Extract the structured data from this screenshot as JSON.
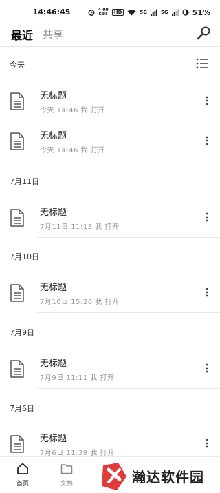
{
  "status_bar": {
    "time": "14:46:45",
    "net_speed_top": "4.00",
    "net_speed_bottom": "KB/S",
    "hd": "HD",
    "signal_1": "5G",
    "signal_2": "5G",
    "battery": "51%"
  },
  "header": {
    "tab_recent": "最近",
    "tab_share": "共享"
  },
  "sections": [
    {
      "title": "今天",
      "files": [
        {
          "name": "无标题",
          "meta": "今天 14:46 我 打开"
        },
        {
          "name": "无标题",
          "meta": "今天 14:46 我 打开"
        }
      ]
    },
    {
      "title": "7月11日",
      "files": [
        {
          "name": "无标题",
          "meta": "7月11日 11:13 我 打开"
        }
      ]
    },
    {
      "title": "7月10日",
      "files": [
        {
          "name": "无标题",
          "meta": "7月10日 15:26 我 打开"
        }
      ]
    },
    {
      "title": "7月9日",
      "files": [
        {
          "name": "无标题",
          "meta": "7月9日 11:11 我 打开"
        }
      ]
    },
    {
      "title": "7月6日",
      "files": [
        {
          "name": "无标题",
          "meta": "7月6日 11:39 我 打开"
        }
      ]
    }
  ],
  "bottom_nav": {
    "home": "首页",
    "docs": "文档"
  },
  "watermark": {
    "text": "瀚达软件园"
  },
  "icons": {
    "search": "search-icon",
    "list_view": "list-view-icon",
    "document": "document-icon",
    "more": "more-vertical-icon",
    "home": "home-icon",
    "folder": "folder-icon"
  },
  "colors": {
    "text_primary": "#222222",
    "text_secondary": "#9a9a9a",
    "divider": "#e8e8e8",
    "watermark_red": "#e03a3a"
  }
}
